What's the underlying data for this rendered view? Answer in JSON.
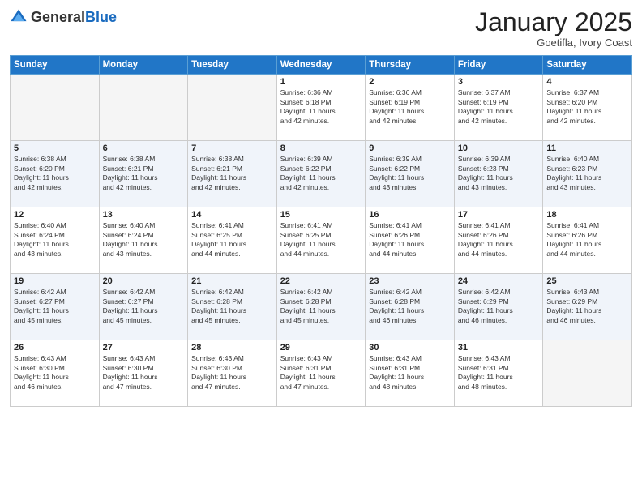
{
  "header": {
    "logo_general": "General",
    "logo_blue": "Blue",
    "month": "January 2025",
    "location": "Goetifla, Ivory Coast"
  },
  "weekdays": [
    "Sunday",
    "Monday",
    "Tuesday",
    "Wednesday",
    "Thursday",
    "Friday",
    "Saturday"
  ],
  "weeks": [
    [
      {
        "day": "",
        "info": ""
      },
      {
        "day": "",
        "info": ""
      },
      {
        "day": "",
        "info": ""
      },
      {
        "day": "1",
        "info": "Sunrise: 6:36 AM\nSunset: 6:18 PM\nDaylight: 11 hours\nand 42 minutes."
      },
      {
        "day": "2",
        "info": "Sunrise: 6:36 AM\nSunset: 6:19 PM\nDaylight: 11 hours\nand 42 minutes."
      },
      {
        "day": "3",
        "info": "Sunrise: 6:37 AM\nSunset: 6:19 PM\nDaylight: 11 hours\nand 42 minutes."
      },
      {
        "day": "4",
        "info": "Sunrise: 6:37 AM\nSunset: 6:20 PM\nDaylight: 11 hours\nand 42 minutes."
      }
    ],
    [
      {
        "day": "5",
        "info": "Sunrise: 6:38 AM\nSunset: 6:20 PM\nDaylight: 11 hours\nand 42 minutes."
      },
      {
        "day": "6",
        "info": "Sunrise: 6:38 AM\nSunset: 6:21 PM\nDaylight: 11 hours\nand 42 minutes."
      },
      {
        "day": "7",
        "info": "Sunrise: 6:38 AM\nSunset: 6:21 PM\nDaylight: 11 hours\nand 42 minutes."
      },
      {
        "day": "8",
        "info": "Sunrise: 6:39 AM\nSunset: 6:22 PM\nDaylight: 11 hours\nand 42 minutes."
      },
      {
        "day": "9",
        "info": "Sunrise: 6:39 AM\nSunset: 6:22 PM\nDaylight: 11 hours\nand 43 minutes."
      },
      {
        "day": "10",
        "info": "Sunrise: 6:39 AM\nSunset: 6:23 PM\nDaylight: 11 hours\nand 43 minutes."
      },
      {
        "day": "11",
        "info": "Sunrise: 6:40 AM\nSunset: 6:23 PM\nDaylight: 11 hours\nand 43 minutes."
      }
    ],
    [
      {
        "day": "12",
        "info": "Sunrise: 6:40 AM\nSunset: 6:24 PM\nDaylight: 11 hours\nand 43 minutes."
      },
      {
        "day": "13",
        "info": "Sunrise: 6:40 AM\nSunset: 6:24 PM\nDaylight: 11 hours\nand 43 minutes."
      },
      {
        "day": "14",
        "info": "Sunrise: 6:41 AM\nSunset: 6:25 PM\nDaylight: 11 hours\nand 44 minutes."
      },
      {
        "day": "15",
        "info": "Sunrise: 6:41 AM\nSunset: 6:25 PM\nDaylight: 11 hours\nand 44 minutes."
      },
      {
        "day": "16",
        "info": "Sunrise: 6:41 AM\nSunset: 6:26 PM\nDaylight: 11 hours\nand 44 minutes."
      },
      {
        "day": "17",
        "info": "Sunrise: 6:41 AM\nSunset: 6:26 PM\nDaylight: 11 hours\nand 44 minutes."
      },
      {
        "day": "18",
        "info": "Sunrise: 6:41 AM\nSunset: 6:26 PM\nDaylight: 11 hours\nand 44 minutes."
      }
    ],
    [
      {
        "day": "19",
        "info": "Sunrise: 6:42 AM\nSunset: 6:27 PM\nDaylight: 11 hours\nand 45 minutes."
      },
      {
        "day": "20",
        "info": "Sunrise: 6:42 AM\nSunset: 6:27 PM\nDaylight: 11 hours\nand 45 minutes."
      },
      {
        "day": "21",
        "info": "Sunrise: 6:42 AM\nSunset: 6:28 PM\nDaylight: 11 hours\nand 45 minutes."
      },
      {
        "day": "22",
        "info": "Sunrise: 6:42 AM\nSunset: 6:28 PM\nDaylight: 11 hours\nand 45 minutes."
      },
      {
        "day": "23",
        "info": "Sunrise: 6:42 AM\nSunset: 6:28 PM\nDaylight: 11 hours\nand 46 minutes."
      },
      {
        "day": "24",
        "info": "Sunrise: 6:42 AM\nSunset: 6:29 PM\nDaylight: 11 hours\nand 46 minutes."
      },
      {
        "day": "25",
        "info": "Sunrise: 6:43 AM\nSunset: 6:29 PM\nDaylight: 11 hours\nand 46 minutes."
      }
    ],
    [
      {
        "day": "26",
        "info": "Sunrise: 6:43 AM\nSunset: 6:30 PM\nDaylight: 11 hours\nand 46 minutes."
      },
      {
        "day": "27",
        "info": "Sunrise: 6:43 AM\nSunset: 6:30 PM\nDaylight: 11 hours\nand 47 minutes."
      },
      {
        "day": "28",
        "info": "Sunrise: 6:43 AM\nSunset: 6:30 PM\nDaylight: 11 hours\nand 47 minutes."
      },
      {
        "day": "29",
        "info": "Sunrise: 6:43 AM\nSunset: 6:31 PM\nDaylight: 11 hours\nand 47 minutes."
      },
      {
        "day": "30",
        "info": "Sunrise: 6:43 AM\nSunset: 6:31 PM\nDaylight: 11 hours\nand 48 minutes."
      },
      {
        "day": "31",
        "info": "Sunrise: 6:43 AM\nSunset: 6:31 PM\nDaylight: 11 hours\nand 48 minutes."
      },
      {
        "day": "",
        "info": ""
      }
    ]
  ]
}
